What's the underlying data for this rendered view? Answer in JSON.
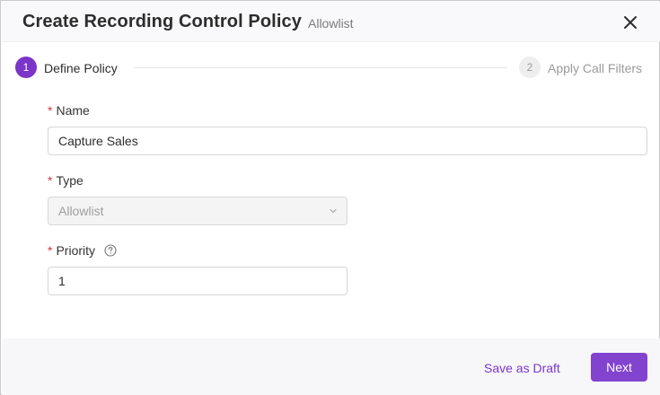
{
  "header": {
    "title": "Create Recording Control Policy",
    "subtitle": "Allowlist",
    "close_icon": "close-icon"
  },
  "steps": [
    {
      "number": "1",
      "label": "Define Policy",
      "state": "active"
    },
    {
      "number": "2",
      "label": "Apply Call Filters",
      "state": "pending"
    }
  ],
  "form": {
    "required_marker": "*",
    "name": {
      "label": "Name",
      "value": "Capture Sales"
    },
    "type": {
      "label": "Type",
      "value": "Allowlist",
      "disabled": true
    },
    "priority": {
      "label": "Priority",
      "value": "1",
      "help_icon": "question-circle-icon"
    }
  },
  "footer": {
    "save_draft_label": "Save as Draft",
    "next_label": "Next"
  },
  "colors": {
    "accent": "#7b35c9",
    "required": "#d9363e"
  }
}
